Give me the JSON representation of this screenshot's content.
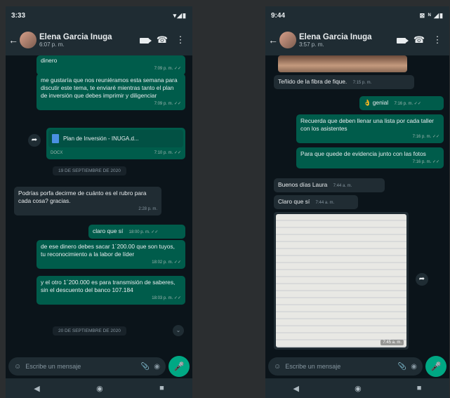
{
  "left": {
    "status": {
      "time": "3:33",
      "icons": "▾◢▮"
    },
    "header": {
      "name": "Elena Garcia Inuga",
      "subtitle": "6:07 p. m."
    },
    "messages": {
      "m1_text": "dinero",
      "m1_time": "7:09 p. m. ✓✓",
      "m2_text": "me gustaría que nos reuniéramos esta semana para discutir este tema, te enviaré mientras tanto el plan de inversión que debes imprimir y diligenciar",
      "m2_time": "7:09 p. m. ✓✓",
      "doc_name": "Plan de Inversión - INUGA.d...",
      "doc_ext": "DOCX",
      "doc_time": "7:10 p. m. ✓✓",
      "date1": "19 DE SEPTIEMBRE DE 2020",
      "m3_text": "Podrías porfa decirme de cuánto es el rubro para cada cosa? gracias.",
      "m3_time": "2:28 p. m.",
      "m4_text": "claro que sí",
      "m4_time": "18:00 p. m. ✓✓",
      "m5_text": "de ese dinero debes sacar 1´200.00 que son tuyos, tu reconocimiento a la labor de líder",
      "m5_time": "18:02 p. m. ✓✓",
      "m6_text": "y el otro 1´200.000 es para transmisión de saberes, sin el descuento del banco 107.184",
      "m6_time": "18:03 p. m. ✓✓",
      "date2": "20 DE SEPTIEMBRE DE 2020"
    },
    "composer_placeholder": "Escribe un mensaje"
  },
  "right": {
    "status": {
      "time": "9:44",
      "icons": "⊠ ᴺ ◢▮"
    },
    "header": {
      "name": "Elena Garcia Inuga",
      "subtitle": "3:57 p. m."
    },
    "messages": {
      "r1_text": "Teñido de la fibra de fique.",
      "r1_time": "7:15 p. m.",
      "r2_text": "👌 genial",
      "r2_time": "7:16 p. m. ✓✓",
      "r3_text": "Recuerda que deben llenar una lista por cada taller con los asistentes",
      "r3_time": "7:16 p. m. ✓✓",
      "r4_text": "Para que quede de evidencia junto con las fotos",
      "r4_time": "7:16 p. m. ✓✓",
      "r5_text": "Buenos días Laura",
      "r5_time": "7:44 a. m.",
      "r6_text": "Claro que sí",
      "r6_time": "7:44 a. m.",
      "photo_time": "7:45 a. m."
    },
    "composer_placeholder": "Escribe un mensaje"
  },
  "icons": {
    "back": "←",
    "video": "video-icon",
    "call": "☎",
    "menu": "⋮",
    "emoji": "☺",
    "attach": "📎",
    "camera": "◉",
    "mic": "🎤",
    "forward": "➦",
    "down": "⌄",
    "nav_back": "◀",
    "nav_home": "◉",
    "nav_recent": "■"
  },
  "colors": {
    "bg": "#0b141a",
    "bar": "#1f2c33",
    "outgoing": "#005c4b",
    "incoming": "#202c33",
    "accent": "#00a884"
  }
}
